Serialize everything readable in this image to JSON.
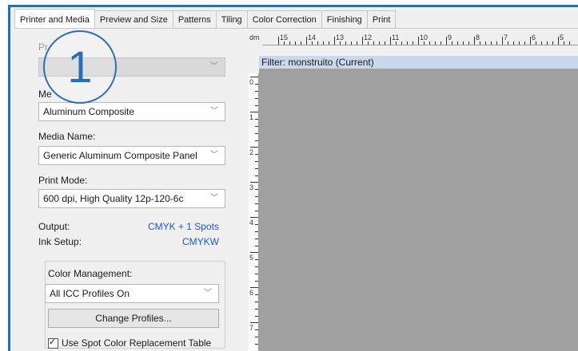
{
  "tabs": [
    "Printer and Media",
    "Preview and Size",
    "Patterns",
    "Tiling",
    "Color Correction",
    "Finishing",
    "Print"
  ],
  "active_tab": 0,
  "badge": "1",
  "panel": {
    "printer_label": "Pr",
    "media_label": "Me",
    "media_value": "Aluminum Composite",
    "media_name_label": "Media Name:",
    "media_name_value": "Generic Aluminum Composite Panel",
    "print_mode_label": "Print Mode:",
    "print_mode_value": "600 dpi, High Quality 12p-120-6c",
    "output_label": "Output:",
    "output_value": "CMYK + 1 Spots",
    "ink_setup_label": "Ink Setup:",
    "ink_setup_value": "CMYKW",
    "color_mgmt_label": "Color Management:",
    "color_mgmt_value": "All ICC Profiles On",
    "change_profiles_label": "Change Profiles...",
    "spot_color_label": "Use Spot Color Replacement Table"
  },
  "preview": {
    "ruler_unit": "dm",
    "ruler_top_numbers": [
      "15",
      "14",
      "13",
      "12",
      "11",
      "10",
      "9",
      "8",
      "7",
      "6",
      "5"
    ],
    "ruler_left_numbers": [
      "0",
      "1",
      "2",
      "3",
      "4",
      "5",
      "6",
      "7",
      "8"
    ],
    "filter_title": "Filter: monstruito (Current)"
  },
  "colors": {
    "accent": "#2a6fb3",
    "link": "#1e59c9",
    "canvas": "#a0a0a0"
  }
}
